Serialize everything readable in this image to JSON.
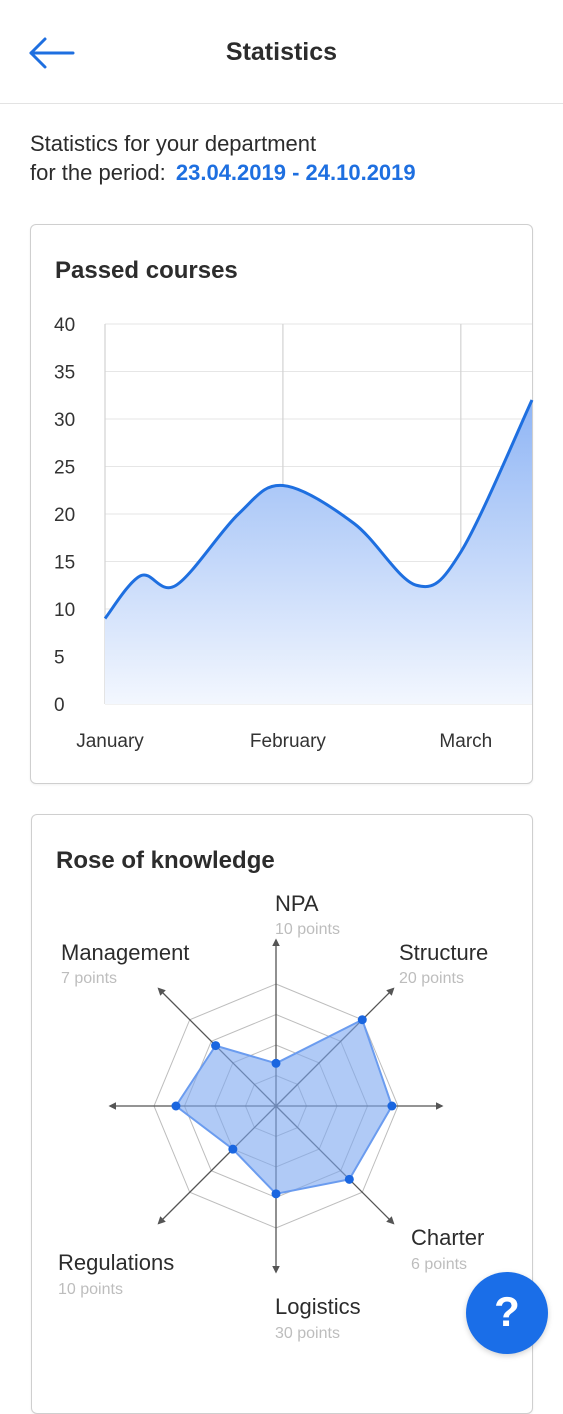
{
  "header": {
    "title": "Statistics",
    "back_icon": "arrow-left-icon"
  },
  "intro": {
    "line1": "Statistics for your department",
    "line2": "for the period:",
    "period": "23.04.2019 - 24.10.2019"
  },
  "colors": {
    "accent": "#1e6fe0",
    "fill_top": "#8fb5f5",
    "fill_bottom": "#f3f7fe",
    "grid": "#e6e6e6"
  },
  "chart_data": [
    {
      "type": "area",
      "title": "Passed courses",
      "categories": [
        "January",
        "February",
        "March"
      ],
      "yticks": [
        0,
        5,
        10,
        15,
        20,
        25,
        30,
        35,
        40
      ],
      "ylim": [
        0,
        40
      ],
      "x": [
        0,
        0.2,
        0.4,
        0.75,
        1.0,
        1.4,
        1.75,
        2.0,
        2.4
      ],
      "values": [
        9,
        13.5,
        12.5,
        20,
        23,
        19,
        12.5,
        16,
        32
      ],
      "grid": true
    },
    {
      "type": "radar",
      "title": "Rose of knowledge",
      "categories": [
        "NPA",
        "Structure",
        "",
        "Charter",
        "Logistics",
        "Regulations",
        "",
        "Management"
      ],
      "points_labels": [
        "10 points",
        "20 points",
        "",
        "6 points",
        "30 points",
        "10 points",
        "",
        "7 points"
      ],
      "values": [
        0.35,
        1.0,
        0.95,
        0.85,
        0.72,
        0.5,
        0.82,
        0.7
      ],
      "rings": 4
    }
  ],
  "help": {
    "label": "?"
  }
}
